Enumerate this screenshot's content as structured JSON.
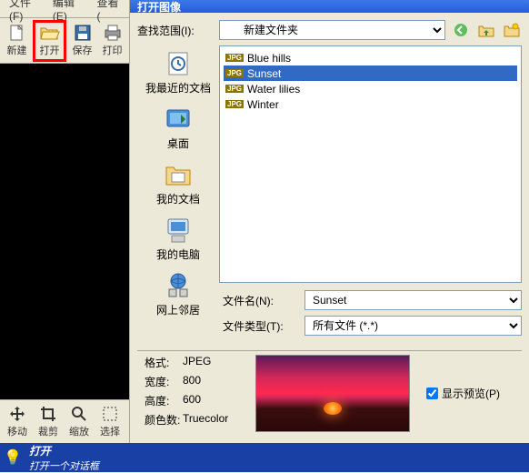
{
  "menu": {
    "file": "文件(F)",
    "edit": "编辑(E)",
    "view": "查看("
  },
  "toolbar": {
    "new": "新建",
    "open": "打开",
    "save": "保存",
    "print": "打印"
  },
  "bottomtools": {
    "move": "移动",
    "crop": "裁剪",
    "zoom": "缩放",
    "select": "选择"
  },
  "status": {
    "title": "打开",
    "desc": "打开一个对话框"
  },
  "dialog": {
    "title": "打开图像",
    "lookin_label": "查找范围(I):",
    "lookin_value": "新建文件夹",
    "places": {
      "recent": "我最近的文档",
      "desktop": "桌面",
      "mydocs": "我的文档",
      "mycomputer": "我的电脑",
      "network": "网上邻居"
    },
    "files": [
      "Blue hills",
      "Sunset",
      "Water lilies",
      "Winter"
    ],
    "selected": "Sunset",
    "filename_label": "文件名(N):",
    "filename_value": "Sunset",
    "filetype_label": "文件类型(T):",
    "filetype_value": "所有文件 (*.*)",
    "meta": {
      "format_k": "格式:",
      "format_v": "JPEG",
      "width_k": "宽度:",
      "width_v": "800",
      "height_k": "高度:",
      "height_v": "600",
      "colors_k": "颜色数:",
      "colors_v": "Truecolor"
    },
    "preview_label": "显示预览(P)"
  }
}
